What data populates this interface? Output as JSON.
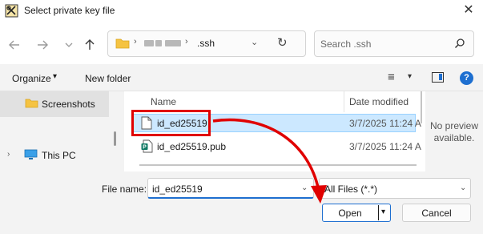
{
  "window": {
    "title": "Select private key file",
    "close_glyph": "✕"
  },
  "nav": {
    "back_icon": "arrow-left-icon",
    "forward_icon": "arrow-right-icon",
    "recent_icon": "chevron-down-icon",
    "up_icon": "arrow-up-icon"
  },
  "address": {
    "separator": "›",
    "current_folder": ".ssh",
    "chevron": "⌄",
    "refresh_glyph": "↻"
  },
  "search": {
    "placeholder": "Search .ssh"
  },
  "toolbar": {
    "organize_label": "Organize",
    "new_folder_label": "New folder",
    "caret": "▾",
    "view_glyph": "≡"
  },
  "sidebar": {
    "items": [
      {
        "label": "Screenshots",
        "icon": "folder-icon",
        "selected": true
      },
      {
        "label": "This PC",
        "icon": "computer-icon",
        "expand": "›"
      }
    ]
  },
  "file_list": {
    "columns": [
      "Name",
      "Date modified"
    ],
    "rows": [
      {
        "name": "id_ed25519",
        "date": "3/7/2025 11:24 A",
        "icon": "file-icon",
        "selected": true
      },
      {
        "name": "id_ed25519.pub",
        "date": "3/7/2025 11:24 A",
        "icon": "publisher-file-icon",
        "selected": false
      }
    ]
  },
  "preview": {
    "text_line1": "No preview",
    "text_line2": "available."
  },
  "footer": {
    "file_name_label": "File name:",
    "file_name_value": "id_ed25519",
    "file_type_value": "All Files (*.*)",
    "chevron": "⌄",
    "open_label": "Open",
    "open_caret": "▾",
    "cancel_label": "Cancel"
  },
  "colors": {
    "accent": "#1e6fd0",
    "selection": "#cce8ff",
    "annotation": "#e00000"
  }
}
